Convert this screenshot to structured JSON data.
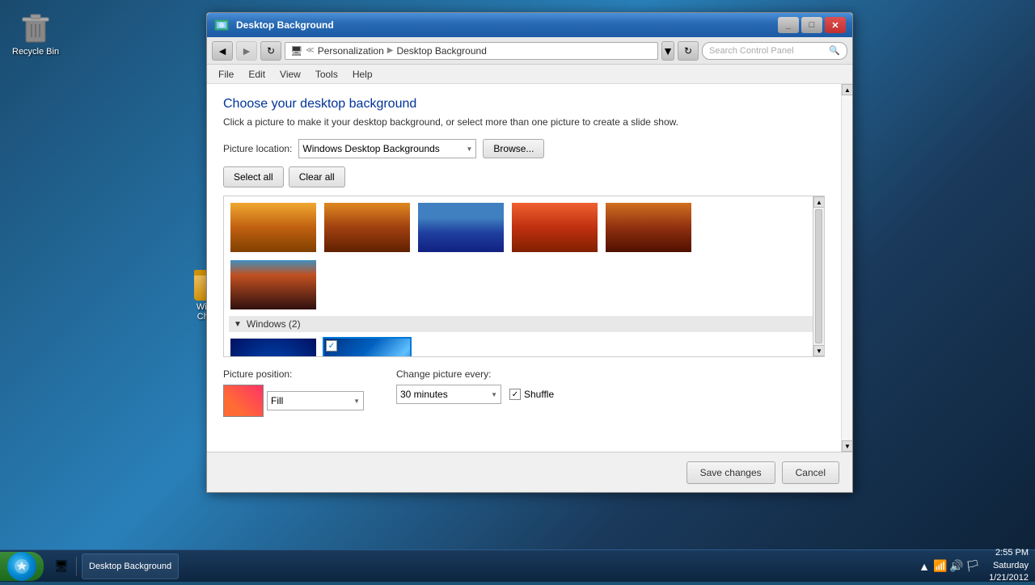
{
  "desktop": {
    "recycle_bin_label": "Recycle Bin",
    "folder_label": "Wind...\nChar..."
  },
  "window": {
    "title": "Desktop Background",
    "title_bar_text": "Desktop Background"
  },
  "address": {
    "back_btn": "◄",
    "forward_btn": "►",
    "path_parts": [
      "Personalization",
      "Desktop Background"
    ],
    "search_placeholder": "Search Control Panel"
  },
  "menu": {
    "items": [
      "File",
      "Edit",
      "View",
      "Tools",
      "Help"
    ]
  },
  "content": {
    "heading": "Choose your desktop background",
    "description": "Click a picture to make it your desktop background, or select more than one picture to create a slide show.",
    "location_label": "Picture location:",
    "location_value": "Windows Desktop Backgrounds",
    "browse_btn": "Browse...",
    "select_all_btn": "Select all",
    "clear_all_btn": "Clear all",
    "windows_section": "Windows (2)",
    "position_label": "Picture position:",
    "position_value": "Fill",
    "change_label": "Change picture every:",
    "interval_value": "30 minutes",
    "shuffle_label": "Shuffle",
    "shuffle_checked": true
  },
  "buttons": {
    "save_label": "Save changes",
    "cancel_label": "Cancel"
  },
  "taskbar": {
    "time": "2:55 PM",
    "date": "Saturday\n1/21/2012",
    "taskbar_item_label": "Desktop Background"
  }
}
